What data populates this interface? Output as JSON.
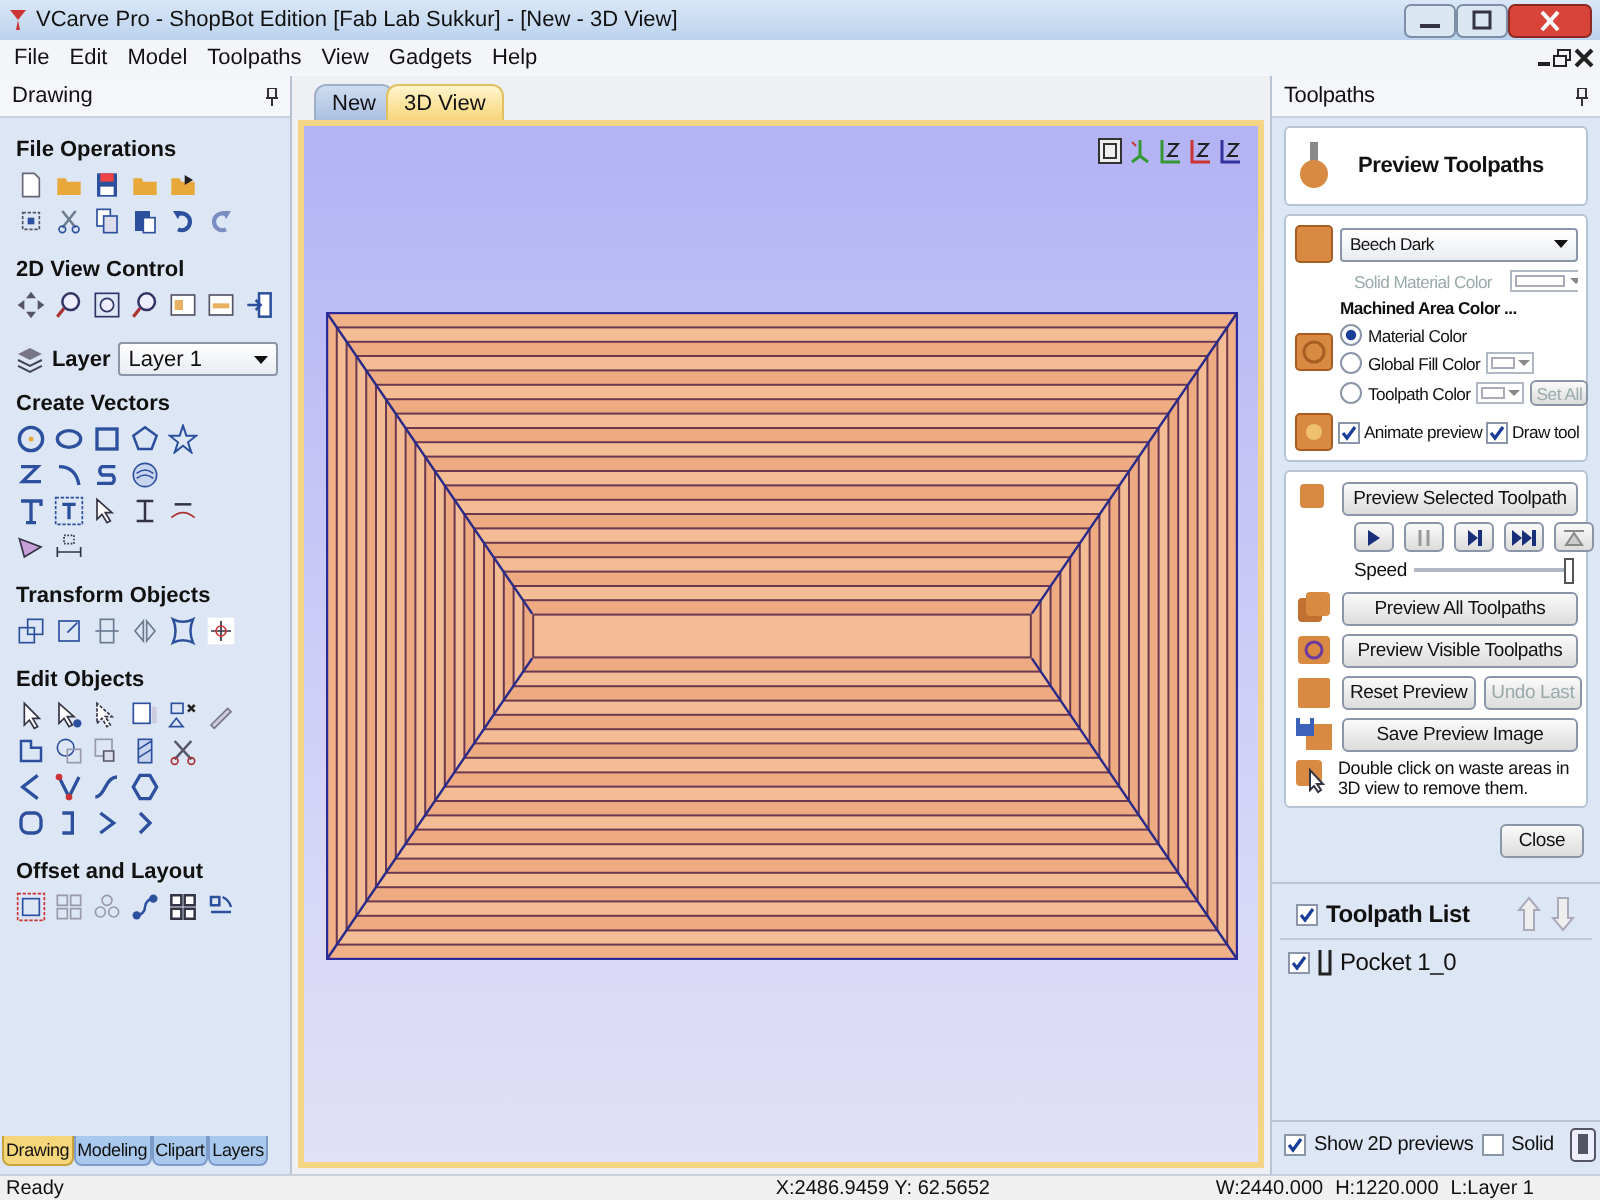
{
  "window": {
    "title": "VCarve Pro - ShopBot Edition [Fab Lab Sukkur] - [New - 3D View]"
  },
  "menu": [
    "File",
    "Edit",
    "Model",
    "Toolpaths",
    "View",
    "Gadgets",
    "Help"
  ],
  "left_panel": {
    "title": "Drawing",
    "sections": [
      {
        "kind": "icons",
        "title": "File Operations"
      },
      {
        "kind": "icons",
        "title": "2D View Control"
      },
      {
        "kind": "layer",
        "label": "Layer",
        "value": "Layer 1"
      },
      {
        "kind": "icons",
        "title": "Create Vectors"
      },
      {
        "kind": "icons",
        "title": "Transform Objects"
      },
      {
        "kind": "icons",
        "title": "Edit Objects"
      },
      {
        "kind": "icons",
        "title": "Offset and Layout"
      }
    ],
    "tabs": [
      {
        "label": "Drawing",
        "selected": true
      },
      {
        "label": "Modeling",
        "selected": false
      },
      {
        "label": "Clipart",
        "selected": false
      },
      {
        "label": "Layers",
        "selected": false
      }
    ]
  },
  "doc_tabs": [
    {
      "label": "New",
      "selected": false
    },
    {
      "label": "3D View",
      "selected": true
    }
  ],
  "right_panel": {
    "title": "Toolpaths",
    "preview_title": "Preview Toolpaths",
    "material": "Beech Dark",
    "solid_material": {
      "label": "Solid Material Color",
      "disabled": true
    },
    "machined_heading": "Machined Area Color ...",
    "color_options": [
      {
        "label": "Material Color",
        "selected": true
      },
      {
        "label": "Global Fill Color",
        "selected": false
      },
      {
        "label": "Toolpath Color",
        "selected": false
      }
    ],
    "set_all": {
      "label": "Set All",
      "disabled": true
    },
    "checks": [
      {
        "label": "Animate preview",
        "checked": true
      },
      {
        "label": "Draw tool",
        "checked": true
      }
    ],
    "preview_selected": "Preview Selected Toolpath",
    "speed": {
      "label": "Speed",
      "level": 1.0
    },
    "preview_all": "Preview All Toolpaths",
    "preview_visible": "Preview Visible Toolpaths",
    "reset": {
      "label": "Reset Preview",
      "disabled": false
    },
    "undo_last": {
      "label": "Undo Last",
      "disabled": true
    },
    "save_image": "Save Preview Image",
    "hint": "Double click on waste areas in 3D view to remove them.",
    "close": "Close",
    "toolpath_list": {
      "label": "Toolpath List",
      "checked": true
    },
    "toolpaths": [
      {
        "name": "Pocket 1_0",
        "checked": true
      }
    ],
    "show_2d": {
      "label": "Show 2D previews",
      "checked": true
    },
    "solid": {
      "label": "Solid",
      "checked": false
    }
  },
  "status_bar": {
    "message": "Ready",
    "coords": "X:2486.9459 Y: 62.5652",
    "width": "W:2440.000",
    "height": "H:1220.000",
    "layer": "L:Layer 1"
  }
}
